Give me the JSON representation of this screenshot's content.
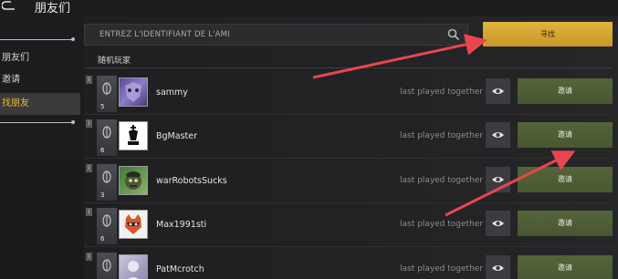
{
  "header": {
    "title": "朋友们",
    "back_icon": "back-arrow-icon"
  },
  "sidebar": {
    "items": [
      {
        "label": "朋友们",
        "active": false
      },
      {
        "label": "邀请",
        "active": false
      },
      {
        "label": "找朋友",
        "active": true
      }
    ]
  },
  "search": {
    "placeholder": "ENTREZ L'IDENTIFIANT DE L'AMI",
    "value": "",
    "icon": "search-icon"
  },
  "find_button": {
    "label": "寻找"
  },
  "section": {
    "label": "随机玩家"
  },
  "players": [
    {
      "name": "sammy",
      "rank": "5",
      "status": "last played together",
      "invite_label": "邀请",
      "avatar": "purple-emblem-avatar"
    },
    {
      "name": "BgMaster",
      "rank": "6",
      "status": "last played together",
      "invite_label": "邀请",
      "avatar": "chess-king-avatar"
    },
    {
      "name": "warRobotsSucks",
      "rank": "3",
      "status": "last played together",
      "invite_label": "邀请",
      "avatar": "zombie-avatar"
    },
    {
      "name": "Max1991sti",
      "rank": "6",
      "status": "last played together",
      "invite_label": "邀请",
      "avatar": "raccoon-avatar"
    },
    {
      "name": "PatMcrotch",
      "rank": "",
      "status": "last played together",
      "invite_label": "邀请",
      "avatar": "portrait-avatar"
    }
  ],
  "colors": {
    "accent": "#e1b33e",
    "invite": "#55653a",
    "arrow": "#e8464f",
    "active_sidebar_text": "#e7b53a"
  }
}
